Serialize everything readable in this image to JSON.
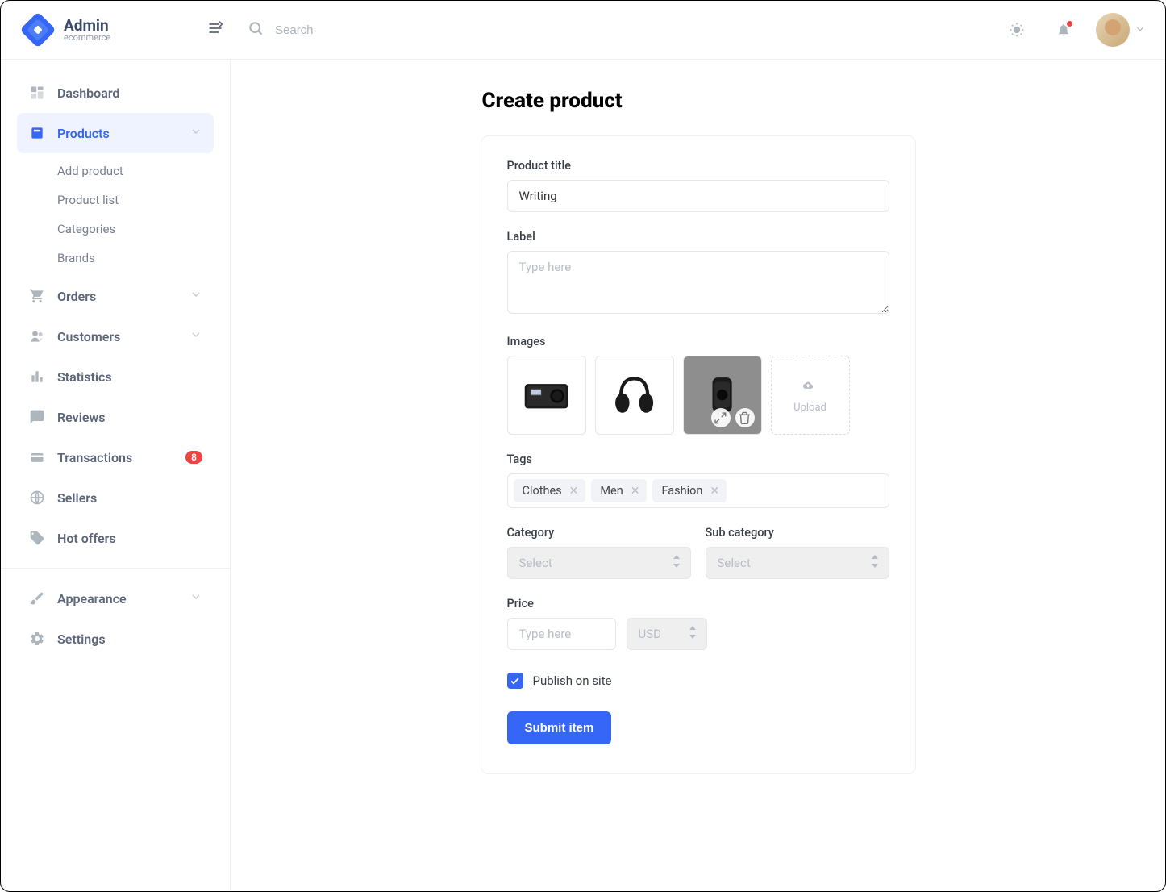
{
  "brand": {
    "title": "Admin",
    "subtitle": "ecommerce"
  },
  "search": {
    "placeholder": "Search"
  },
  "sidebar": {
    "items": [
      {
        "label": "Dashboard",
        "icon": "dashboard"
      },
      {
        "label": "Products",
        "icon": "products",
        "expandable": true,
        "active": true
      },
      {
        "label": "Orders",
        "icon": "orders",
        "expandable": true
      },
      {
        "label": "Customers",
        "icon": "customers",
        "expandable": true
      },
      {
        "label": "Statistics",
        "icon": "statistics"
      },
      {
        "label": "Reviews",
        "icon": "reviews"
      },
      {
        "label": "Transactions",
        "icon": "transactions",
        "badge": "8"
      },
      {
        "label": "Sellers",
        "icon": "sellers"
      },
      {
        "label": "Hot offers",
        "icon": "hot-offers"
      }
    ],
    "productsSub": [
      {
        "label": "Add product"
      },
      {
        "label": "Product list"
      },
      {
        "label": "Categories"
      },
      {
        "label": "Brands"
      }
    ],
    "bottom": [
      {
        "label": "Appearance",
        "icon": "appearance",
        "expandable": true
      },
      {
        "label": "Settings",
        "icon": "settings"
      }
    ]
  },
  "page": {
    "title": "Create product"
  },
  "form": {
    "productTitle": {
      "label": "Product title",
      "value": "Writing"
    },
    "label": {
      "label": "Label",
      "placeholder": "Type here"
    },
    "images": {
      "label": "Images",
      "uploadLabel": "Upload",
      "thumbs": [
        "camera",
        "headphones",
        "watch"
      ]
    },
    "tags": {
      "label": "Tags",
      "items": [
        "Clothes",
        "Men",
        "Fashion"
      ]
    },
    "category": {
      "label": "Category",
      "placeholder": "Select"
    },
    "subCategory": {
      "label": "Sub category",
      "placeholder": "Select"
    },
    "price": {
      "label": "Price",
      "placeholder": "Type here",
      "currency": "USD"
    },
    "publish": {
      "label": "Publish on site",
      "checked": true
    },
    "submit": {
      "label": "Submit item"
    }
  }
}
